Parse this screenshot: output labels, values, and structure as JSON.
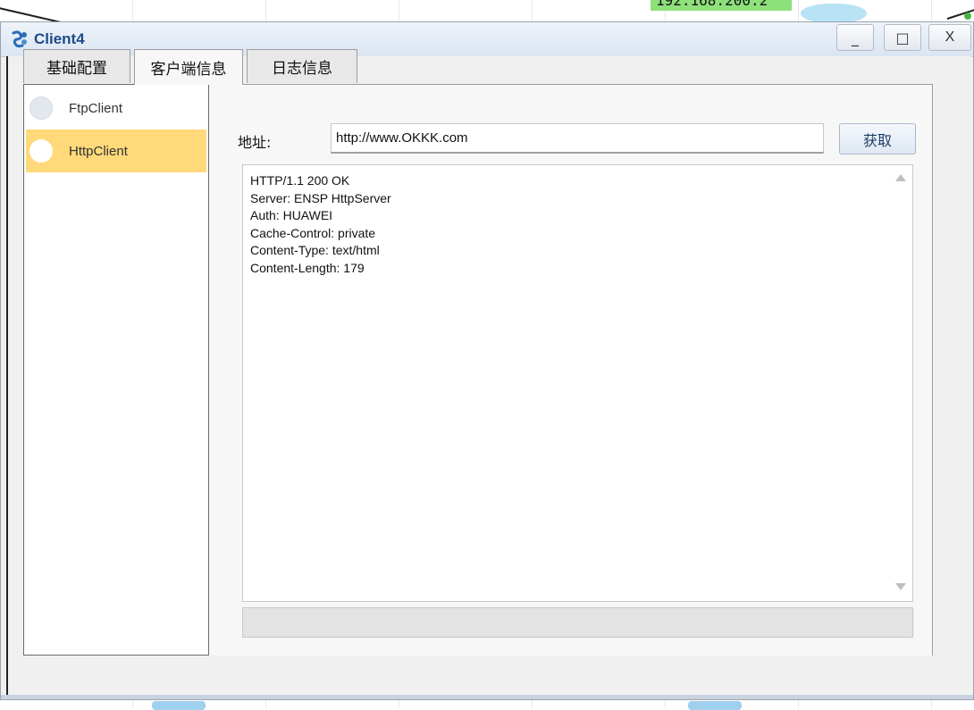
{
  "background": {
    "ip_label": "192.168.200.2"
  },
  "window": {
    "title": "Client4",
    "controls": {
      "minimize": "_",
      "maximize": "□",
      "close": "X"
    }
  },
  "tabs": [
    {
      "label": "基础配置",
      "active": false
    },
    {
      "label": "客户端信息",
      "active": true
    },
    {
      "label": "日志信息",
      "active": false
    }
  ],
  "client_list": [
    {
      "label": "FtpClient",
      "selected": false
    },
    {
      "label": "HttpClient",
      "selected": true
    }
  ],
  "http_client": {
    "address_label": "地址:",
    "address_value": "http://www.OKKK.com",
    "fetch_button": "获取",
    "response": "HTTP/1.1 200 OK\nServer: ENSP HttpServer\nAuth: HUAWEI\nCache-Control: private\nContent-Type: text/html\nContent-Length: 179",
    "status_text": ""
  },
  "colors": {
    "selected_item": "#ffd97a",
    "title_text": "#1e4b8a",
    "ip_label_bg": "#8ee07a"
  },
  "icons": {
    "app": "ensp-client-icon",
    "scroll_up": "triangle-up-icon",
    "scroll_down": "triangle-down-icon"
  }
}
